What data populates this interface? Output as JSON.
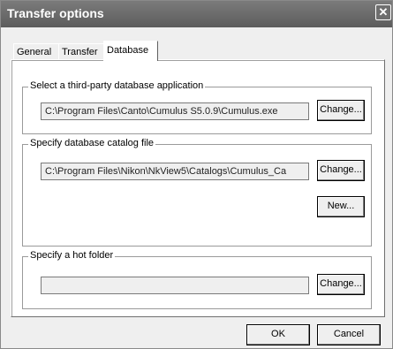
{
  "window": {
    "title": "Transfer options",
    "close_glyph": "✕",
    "close_icon": "close-icon"
  },
  "tabs": [
    {
      "label": "General"
    },
    {
      "label": "Transfer"
    },
    {
      "label": "Database",
      "active": true
    }
  ],
  "groups": {
    "app": {
      "label": "Select a third-party database application",
      "path": "C:\\Program Files\\Canto\\Cumulus S5.0.9\\Cumulus.exe",
      "change_label": "Change..."
    },
    "catalog": {
      "label": "Specify database catalog file",
      "path": "C:\\Program Files\\Nikon\\NkView5\\Catalogs\\Cumulus_Ca",
      "change_label": "Change...",
      "new_label": "New..."
    },
    "hotfolder": {
      "label": "Specify a hot folder",
      "path": "",
      "change_label": "Change..."
    }
  },
  "footer": {
    "ok_label": "OK",
    "cancel_label": "Cancel"
  }
}
